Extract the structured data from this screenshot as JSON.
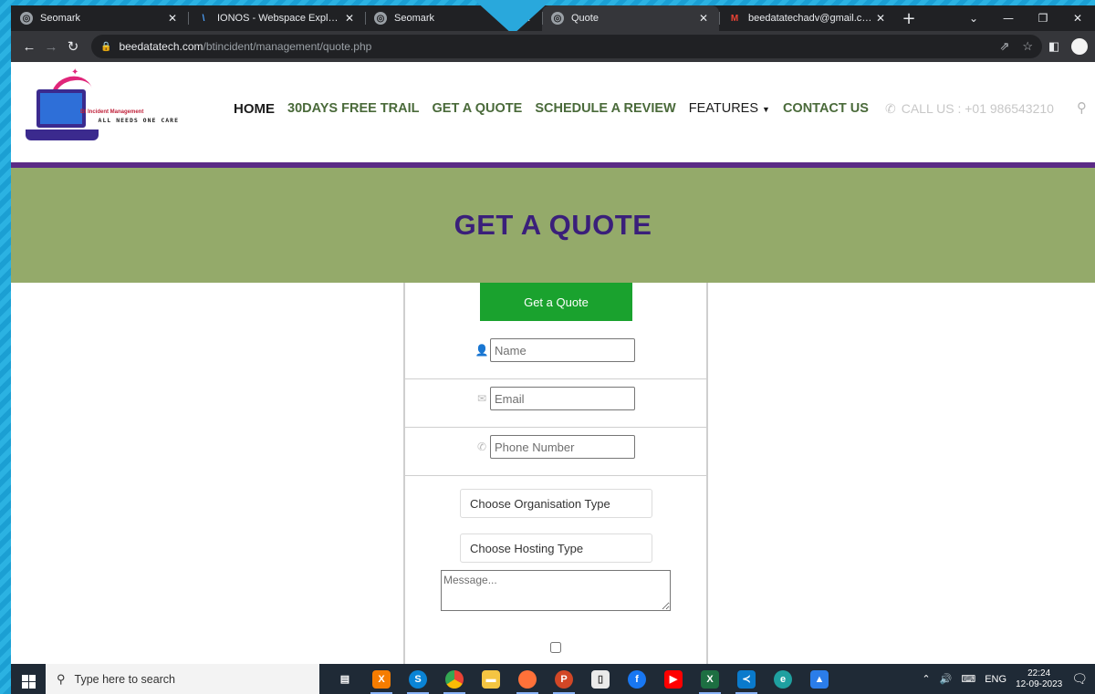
{
  "browser": {
    "tabs": [
      {
        "title": "Seomark",
        "favicon": "globe-icon",
        "active": false
      },
      {
        "title": "IONOS - Webspace Explorer",
        "favicon": "ionos-icon",
        "active": false
      },
      {
        "title": "Seomark",
        "favicon": "globe-icon",
        "active": false
      },
      {
        "title": "Quote",
        "favicon": "globe-icon",
        "active": true
      },
      {
        "title": "beedatatechadv@gmail.com (o",
        "favicon": "gmail-icon",
        "active": false
      }
    ],
    "url_host": "beedatatech.com",
    "url_path": "/btincident/management/quote.php"
  },
  "site": {
    "logo": {
      "brand": "Bt Incident Management",
      "tagline": "ALL NEEDS ONE CARE"
    },
    "nav": {
      "home": "HOME",
      "trial": "30DAYS FREE TRAIL",
      "quote": "GET A QUOTE",
      "review": "SCHEDULE A REVIEW",
      "features": "FEATURES",
      "contact": "CONTACT US"
    },
    "call_us": "CALL US : +01 986543210",
    "hero_title": "GET A QUOTE",
    "form": {
      "button": "Get a Quote",
      "name_placeholder": "Name",
      "email_placeholder": "Email",
      "phone_placeholder": "Phone Number",
      "org_type": "Choose Organisation Type",
      "hosting_type": "Choose Hosting Type",
      "message_placeholder": "Message..."
    }
  },
  "taskbar": {
    "search_placeholder": "Type here to search",
    "lang": "ENG",
    "time": "22:24",
    "date": "12-09-2023"
  },
  "colors": {
    "hero_bg": "#94aa6a",
    "hero_title": "#3a1f7a",
    "accent_purple": "#5b2a86",
    "quote_button": "#1aa22e"
  }
}
